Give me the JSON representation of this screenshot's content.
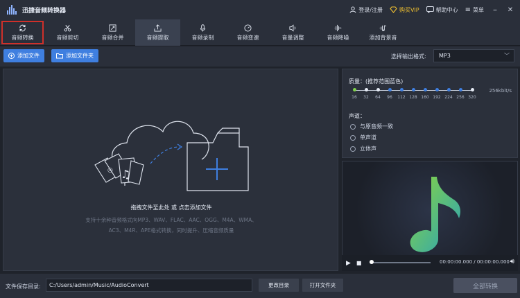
{
  "app": {
    "title": "迅捷音频转换器"
  },
  "titlebar": {
    "login": "登录/注册",
    "vip": "购买VIP",
    "help": "帮助中心",
    "menu": "菜单",
    "minimize": "–",
    "close": "✕"
  },
  "tabs": [
    {
      "label": "音频转换",
      "icon": "refresh-icon"
    },
    {
      "label": "音频剪切",
      "icon": "scissors-icon"
    },
    {
      "label": "音频合并",
      "icon": "merge-icon"
    },
    {
      "label": "音频提取",
      "icon": "extract-icon"
    },
    {
      "label": "音频录制",
      "icon": "microphone-icon"
    },
    {
      "label": "音频变速",
      "icon": "speed-icon"
    },
    {
      "label": "音量调整",
      "icon": "volume-adjust-icon"
    },
    {
      "label": "音频降噪",
      "icon": "denoise-icon"
    },
    {
      "label": "添加背景音",
      "icon": "background-music-icon"
    }
  ],
  "actions": {
    "add_file": "添加文件",
    "add_folder": "添加文件夹",
    "format_label": "选择输出格式:",
    "format_value": "MP3"
  },
  "dropzone": {
    "hint": "拖拽文件至此处 或 点击添加文件",
    "sub": "支持十余种音频格式向MP3、WAV、FLAC、AAC、OGG、M4A、WMA、AC3、M4R、APE格式转换，同时提升、压缩音频质量"
  },
  "quality": {
    "title": "质量：(推荐范围蓝色)",
    "ticks": [
      "16",
      "32",
      "64",
      "96",
      "112",
      "128",
      "160",
      "192",
      "224",
      "256",
      "320"
    ],
    "selected_index": 0,
    "rate": "256kbit/s"
  },
  "channel": {
    "title": "声道：",
    "options": [
      "与原音频一致",
      "单声道",
      "立体声"
    ]
  },
  "player": {
    "time": "00:00:00.000 / 00:00:00.000",
    "progress": 0
  },
  "bottom": {
    "save_label": "文件保存目录:",
    "save_path": "C:/Users/admin/Music/AudioConvert",
    "change_dir": "更改目录",
    "open_folder": "打开文件夹",
    "convert_all": "全部转换"
  },
  "colors": {
    "accent": "#3f7fe0",
    "vip": "#f2c230",
    "note_green": "#7fd24a",
    "note_teal": "#2aa8b8"
  }
}
